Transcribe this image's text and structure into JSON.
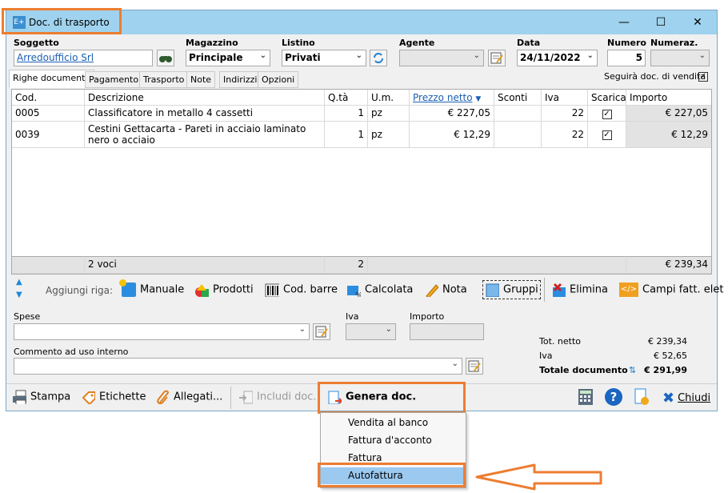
{
  "window": {
    "title": "Doc. di trasporto",
    "app_icon": "E+"
  },
  "header": {
    "soggetto": {
      "label": "Soggetto",
      "value": "Arredoufficio Srl"
    },
    "magazzino": {
      "label": "Magazzino",
      "value": "Principale"
    },
    "listino": {
      "label": "Listino",
      "value": "Privati"
    },
    "agente": {
      "label": "Agente",
      "value": ""
    },
    "data": {
      "label": "Data",
      "value": "24/11/2022"
    },
    "numero": {
      "label": "Numero",
      "value": "5"
    },
    "numeraz": {
      "label": "Numeraz.",
      "value": ""
    }
  },
  "tabs": [
    "Righe documento",
    "Pagamento",
    "Trasporto",
    "Note",
    "Indirizzi",
    "Opzioni"
  ],
  "follow_sale": {
    "label": "Seguirà doc. di vendita",
    "checked": true
  },
  "grid": {
    "columns": [
      "Cod.",
      "Descrizione",
      "Q.tà",
      "U.m.",
      "Prezzo netto",
      "Sconti",
      "Iva",
      "Scarica",
      "Importo"
    ],
    "rows": [
      {
        "cod": "0005",
        "descr": "Classificatore in metallo 4 cassetti",
        "qta": "1",
        "um": "pz",
        "prezzo": "€ 227,05",
        "sconti": "",
        "iva": "22",
        "scarica": true,
        "importo": "€ 227,05"
      },
      {
        "cod": "0039",
        "descr": "Cestini Gettacarta - Pareti in acciaio laminato nero o acciaio",
        "qta": "1",
        "um": "pz",
        "prezzo": "€ 12,29",
        "sconti": "",
        "iva": "22",
        "scarica": true,
        "importo": "€ 12,29"
      }
    ],
    "footer": {
      "voci": "2 voci",
      "qta": "2",
      "importo": "€ 239,34"
    }
  },
  "row_toolbar": {
    "label": "Aggiungi riga:",
    "items": [
      "Manuale",
      "Prodotti",
      "Cod. barre",
      "Calcolata",
      "Nota",
      "Gruppi",
      "Elimina",
      "Campi fatt. elet"
    ]
  },
  "spese": {
    "label": "Spese",
    "value": "",
    "iva_label": "Iva",
    "importo_label": "Importo"
  },
  "commento": {
    "label": "Commento ad uso interno",
    "value": ""
  },
  "totals": {
    "netto_label": "Tot. netto",
    "netto": "€ 239,34",
    "iva_label": "Iva",
    "iva": "€ 52,65",
    "totale_label": "Totale documento",
    "totale": "€ 291,99"
  },
  "bottom": {
    "stampa": "Stampa",
    "etichette": "Etichette",
    "allegati": "Allegati...",
    "includi": "Includi doc.",
    "genera": "Genera doc.",
    "chiudi": "Chiudi"
  },
  "dropdown": [
    "Vendita al banco",
    "Fattura d'acconto",
    "Fattura",
    "Autofattura"
  ],
  "colors": {
    "accent": "#ed7d31",
    "titlebar": "#9fd2ee",
    "selected": "#9bc9ef"
  }
}
